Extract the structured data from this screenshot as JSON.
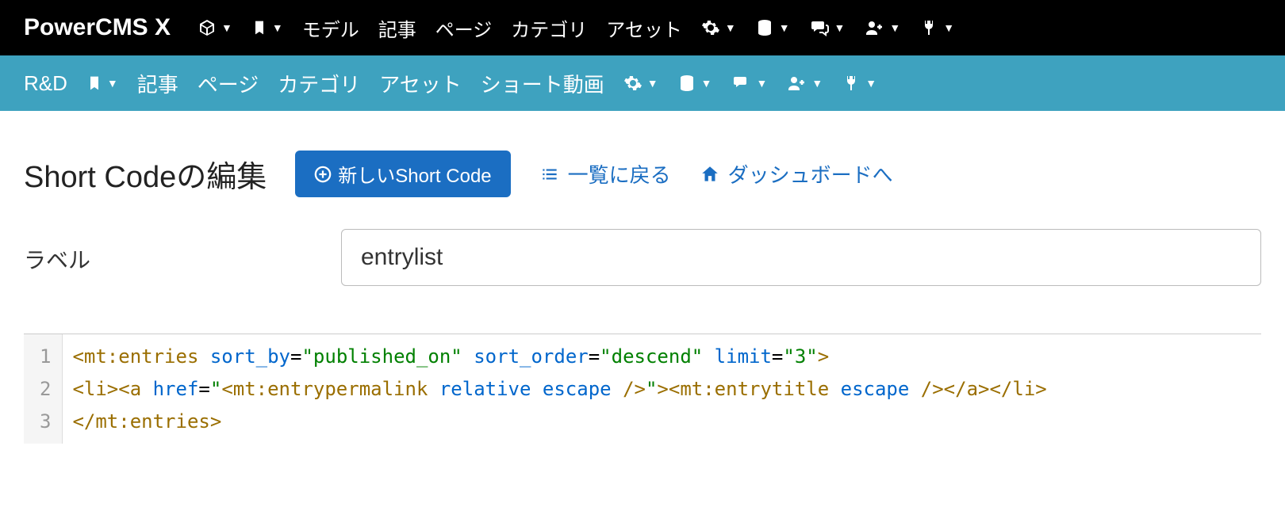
{
  "topbar": {
    "brand": "PowerCMS X",
    "items": [
      "モデル",
      "記事",
      "ページ",
      "カテゴリ",
      "アセット"
    ]
  },
  "subbar": {
    "site": "R&D",
    "items": [
      "記事",
      "ページ",
      "カテゴリ",
      "アセット",
      "ショート動画"
    ]
  },
  "page": {
    "title": "Short Codeの編集",
    "new_button": "新しいShort Code",
    "back_list": "一覧に戻る",
    "dashboard": "ダッシュボードへ"
  },
  "form": {
    "label_field": "ラベル",
    "label_value": "entrylist"
  },
  "editor": {
    "lines": [
      "<mt:entries sort_by=\"published_on\" sort_order=\"descend\" limit=\"3\">",
      "<li><a href=\"<mt:entrypermalink relative escape />\"><mt:entrytitle escape /></a></li>",
      "</mt:entries>"
    ]
  }
}
